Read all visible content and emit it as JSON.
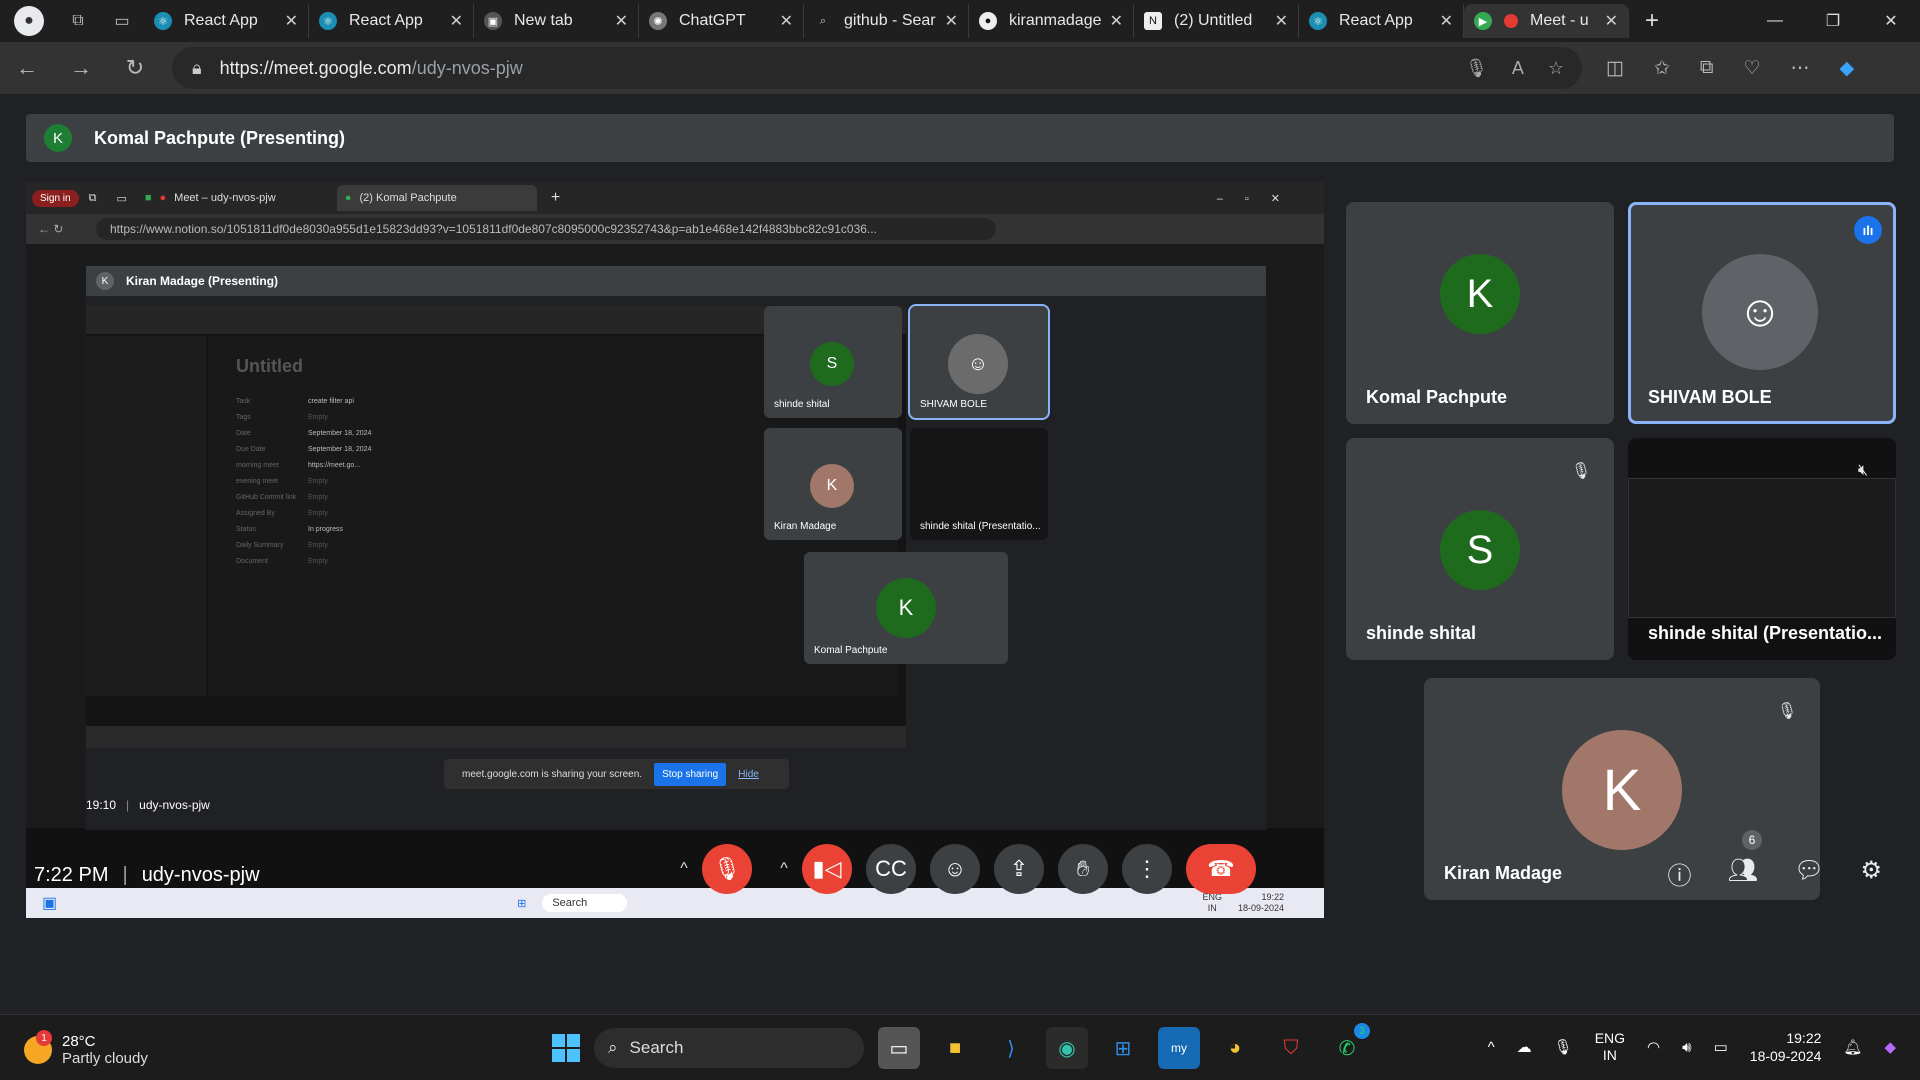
{
  "browser": {
    "tabs": [
      {
        "label": "React App",
        "icon": "react-icon"
      },
      {
        "label": "React App",
        "icon": "react-icon"
      },
      {
        "label": "New tab",
        "icon": "newtab-icon"
      },
      {
        "label": "ChatGPT",
        "icon": "chatgpt-icon"
      },
      {
        "label": "github - Sear",
        "icon": "search-icon"
      },
      {
        "label": "kiranmadage",
        "icon": "github-icon"
      },
      {
        "label": "(2) Untitled",
        "icon": "notion-icon"
      },
      {
        "label": "React App",
        "icon": "react-icon"
      },
      {
        "label": "Meet - u",
        "icon": "meet-icon"
      }
    ],
    "url_host": "https://meet.google.com",
    "url_path": "/udy-nvos-pjw"
  },
  "meet": {
    "presenter_initial": "K",
    "presenting_banner": "Komal Pachpute (Presenting)",
    "inner_browser": {
      "signin": "Sign in",
      "tab1": "Meet – udy-nvos-pjw",
      "tab2": "(2) Komal Pachpute",
      "url": "https://www.notion.so/1051811df0de8030a955d1e15823dd93?v=1051811df0de807c8095000c92352743&p=ab1e468e142f4883bbc82c91c036...",
      "nested_banner": "Kiran Madage (Presenting)",
      "nested_initial": "K",
      "notion_title": "Untitled",
      "notion_rows": [
        {
          "label": "Task",
          "value": "create filter api"
        },
        {
          "label": "Tags",
          "value": "Empty"
        },
        {
          "label": "Date",
          "value": "September 18, 2024"
        },
        {
          "label": "Due Date",
          "value": "September 18, 2024"
        },
        {
          "label": "morning meet",
          "value": "https://meet.go..."
        },
        {
          "label": "evening meet",
          "value": "Empty"
        },
        {
          "label": "GitHub Commit link",
          "value": "Empty"
        },
        {
          "label": "Assigned By",
          "value": "Empty"
        },
        {
          "label": "Status",
          "value": "In progress"
        },
        {
          "label": "Daily Summary",
          "value": "Empty"
        },
        {
          "label": "Document",
          "value": "Empty"
        }
      ],
      "nested_tiles": [
        {
          "name": "shinde shital",
          "initial": "S"
        },
        {
          "name": "SHIVAM BOLE",
          "initial": ""
        },
        {
          "name": "Kiran Madage",
          "initial": "K"
        },
        {
          "name": "shinde shital (Presentatio...",
          "initial": ""
        },
        {
          "name": "Komal Pachpute",
          "initial": "K"
        }
      ],
      "nested_time": "19:10",
      "nested_code": "udy-nvos-pjw",
      "share_text": "meet.google.com is sharing your screen.",
      "stop_sharing": "Stop sharing",
      "hide": "Hide",
      "inner_task_search": "Search",
      "inner_lang1": "ENG",
      "inner_lang2": "IN",
      "inner_time": "19:22",
      "inner_date": "18-09-2024"
    },
    "tiles": [
      {
        "name": "Komal Pachpute",
        "initial": "K",
        "color": "#1e6b1e"
      },
      {
        "name": "SHIVAM BOLE",
        "initial": "",
        "speaking": true
      },
      {
        "name": "shinde shital",
        "initial": "S",
        "color": "#1e6b1e"
      },
      {
        "name": "shinde shital (Presentatio...",
        "initial": ""
      },
      {
        "name": "Kiran Madage",
        "initial": "K",
        "color": "#a1776a"
      }
    ],
    "time": "7:22 PM",
    "code": "udy-nvos-pjw",
    "people_count": "6"
  },
  "taskbar": {
    "temp": "28°C",
    "weather": "Partly cloudy",
    "weather_badge": "1",
    "search": "Search",
    "whatsapp_badge": "3",
    "lang1": "ENG",
    "lang2": "IN",
    "time": "19:22",
    "date": "18-09-2024"
  }
}
